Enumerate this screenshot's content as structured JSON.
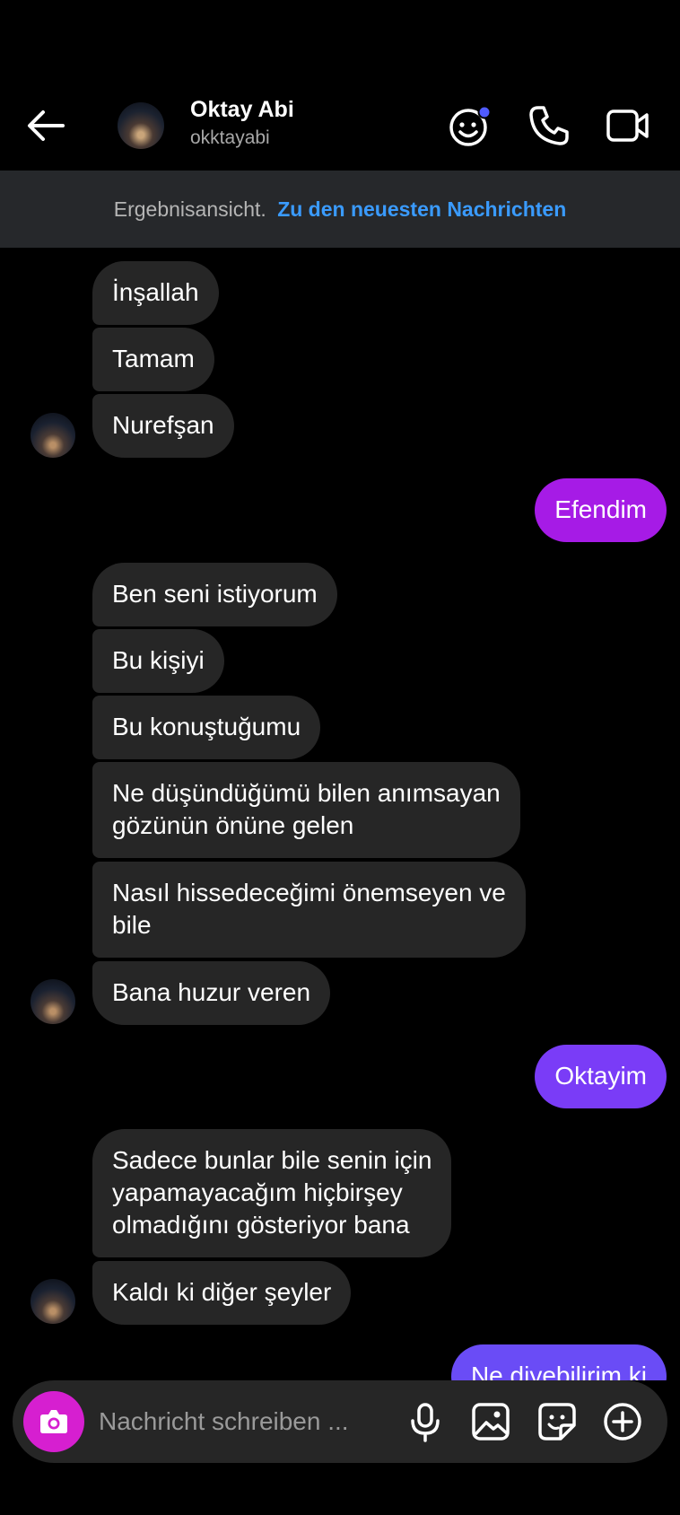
{
  "header": {
    "title": "Oktay Abi",
    "username": "okktayabi"
  },
  "banner": {
    "prefix": "Ergebnisansicht.",
    "link": "Zu den neuesten Nachrichten"
  },
  "messages": [
    {
      "side": "in",
      "text": "İnşallah"
    },
    {
      "side": "in",
      "text": "Tamam"
    },
    {
      "side": "in",
      "text": "Nurefşan"
    },
    {
      "side": "out",
      "text": "Efendim"
    },
    {
      "side": "in",
      "text": "Ben seni istiyorum"
    },
    {
      "side": "in",
      "text": "Bu kişiyi"
    },
    {
      "side": "in",
      "text": "Bu konuştuğumu"
    },
    {
      "side": "in",
      "text": "Ne düşündüğümü bilen anımsayan\ngözünün önüne gelen"
    },
    {
      "side": "in",
      "text": "Nasıl hissedeceğimi önemseyen ve\nbile"
    },
    {
      "side": "in",
      "text": "Bana huzur veren"
    },
    {
      "side": "out",
      "text": "Oktayim"
    },
    {
      "side": "in",
      "text": "Sadece bunlar bile senin için\nyapamayacağım hiçbirşey\nolmadığını gösteriyor bana"
    },
    {
      "side": "in",
      "text": "Kaldı ki diğer şeyler"
    },
    {
      "side": "out",
      "text": "Ne diyebilirim ki"
    }
  ],
  "composer": {
    "placeholder": "Nachricht schreiben ..."
  },
  "colors": {
    "sent_magenta": "#a61be6",
    "sent_violet": "#7a3cf7",
    "sent_blue": "#6a4cf6",
    "received": "#262626",
    "camera": "#d61fd0",
    "link": "#3a9bff"
  }
}
